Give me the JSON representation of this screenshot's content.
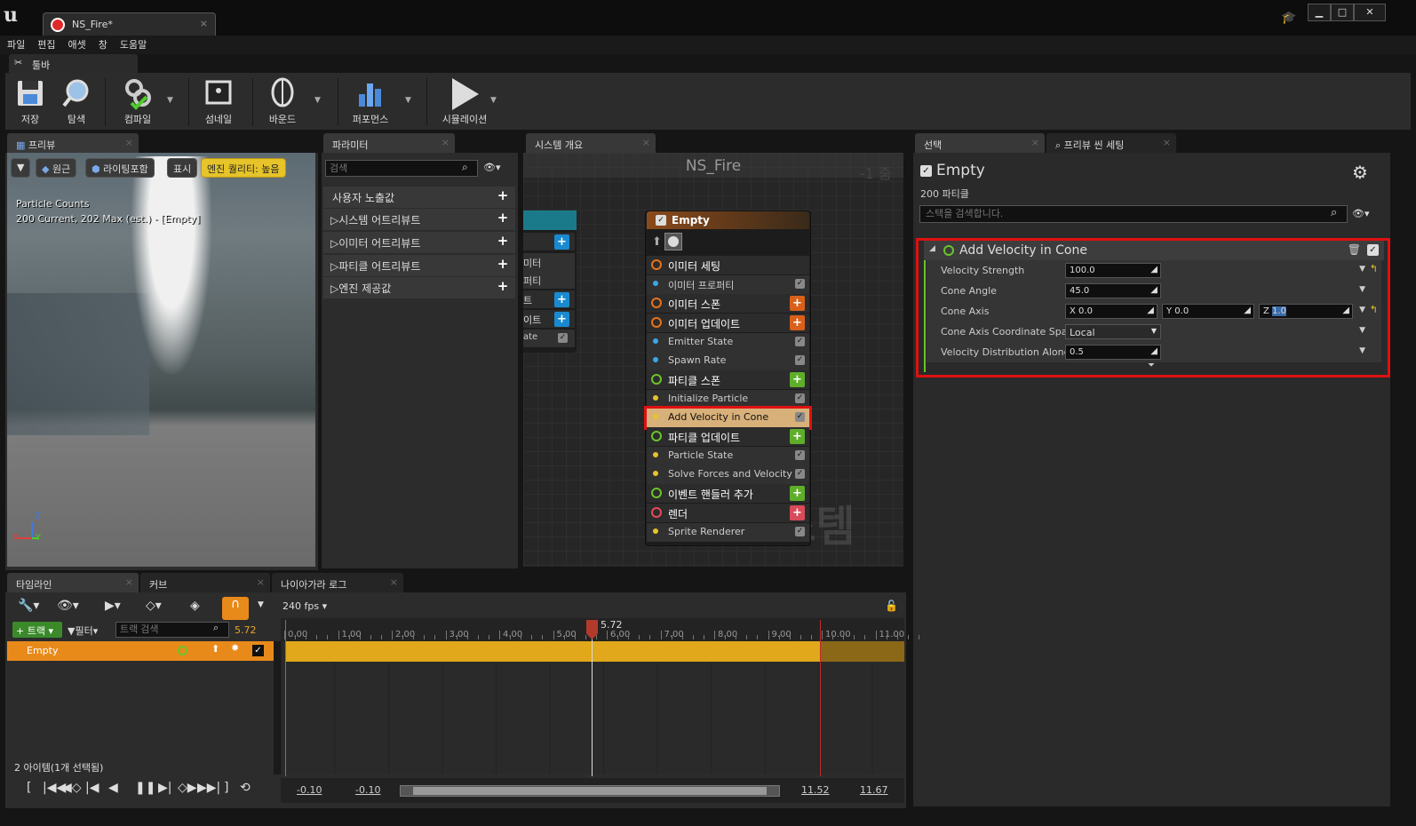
{
  "window": {
    "tab_title": "NS_Fire*"
  },
  "menu": [
    "파일",
    "편집",
    "애셋",
    "창",
    "도움말"
  ],
  "toolbar": {
    "tab_label": "툴바",
    "items": [
      {
        "label": "저장",
        "icon": "save-icon"
      },
      {
        "label": "탐색",
        "icon": "browse-icon"
      },
      {
        "label": "컴파일",
        "icon": "compile-icon"
      },
      {
        "label": "섬네일",
        "icon": "thumbnail-icon"
      },
      {
        "label": "바운드",
        "icon": "bounds-icon"
      },
      {
        "label": "퍼포먼스",
        "icon": "performance-icon"
      },
      {
        "label": "시뮬레이션",
        "icon": "simulation-icon"
      }
    ]
  },
  "preview": {
    "tab": "프리뷰",
    "btn_perspective": "원근",
    "btn_lit": "라이팅포함",
    "btn_show": "표시",
    "btn_quality": "엔진 퀄리티: 높음",
    "stats_line1": "Particle Counts",
    "stats_line2": "200 Current, 202 Max (est.) - [Empty]",
    "axis_z": "Z",
    "axis_y": "Y",
    "axis_x": "X"
  },
  "params": {
    "tab": "파라미터",
    "search_placeholder": "검색",
    "rows": [
      "사용자 노출값",
      "시스템 어트리뷰트",
      "이미터 어트리뷰트",
      "파티클 어트리뷰트",
      "엔진 제공값"
    ]
  },
  "overview": {
    "tab": "시스템 개요",
    "title": "NS_Fire",
    "zoom": "-1 줌",
    "watermark": "시스템",
    "left_node_rows": [
      "미터",
      "퍼티",
      "트",
      "이트",
      "ate"
    ],
    "node": {
      "title": "Empty",
      "rows": [
        {
          "label": "이미터 세팅",
          "kind": "hdr",
          "color": "#e8731a"
        },
        {
          "label": "이미터 프로퍼티",
          "kind": "sub"
        },
        {
          "label": "이미터 스폰",
          "kind": "hdr",
          "color": "#e8731a",
          "plus": "#d9601a"
        },
        {
          "label": "이미터 업데이트",
          "kind": "hdr",
          "color": "#e8731a",
          "plus": "#d9601a"
        },
        {
          "label": "Emitter State",
          "kind": "sub"
        },
        {
          "label": "Spawn Rate",
          "kind": "sub"
        },
        {
          "label": "파티클 스폰",
          "kind": "hdr",
          "color": "#6ac42a",
          "plus": "#5fae2a"
        },
        {
          "label": "Initialize Particle",
          "kind": "sub"
        },
        {
          "label": "Add Velocity in Cone",
          "kind": "sel"
        },
        {
          "label": "파티클 업데이트",
          "kind": "hdr",
          "color": "#6ac42a",
          "plus": "#5fae2a"
        },
        {
          "label": "Particle State",
          "kind": "sub"
        },
        {
          "label": "Solve Forces and Velocity",
          "kind": "sub"
        },
        {
          "label": "이벤트 핸들러 추가",
          "kind": "hdr",
          "color": "#6ac42a",
          "plus": "#5fae2a"
        },
        {
          "label": "렌더",
          "kind": "hdr",
          "color": "#e84a5a",
          "plus": "#d94a5a"
        },
        {
          "label": "Sprite Renderer",
          "kind": "sub"
        }
      ]
    }
  },
  "selection": {
    "tab": "선택",
    "tab2": "프리뷰 씬 세팅",
    "emitter_name": "Empty",
    "count": "200 파티클",
    "search_placeholder": "스택을 검색합니다.",
    "module": "Add Velocity in Cone",
    "props": [
      {
        "name": "Velocity Strength",
        "value": "100.0"
      },
      {
        "name": "Cone Angle",
        "value": "45.0"
      },
      {
        "name": "Cone Axis",
        "x": "0.0",
        "y": "0.0",
        "z": "1.0"
      },
      {
        "name": "Cone Axis Coordinate Spac",
        "value": "Local"
      },
      {
        "name": "Velocity Distribution Along",
        "value": "0.5"
      }
    ]
  },
  "timeline": {
    "tabs": [
      "타임라인",
      "커브",
      "나이아가라 로그"
    ],
    "fps": "240 fps",
    "track_btn": "트랙",
    "filter_btn": "필터",
    "search_placeholder": "트랙 검색",
    "time": "5.72",
    "track_name": "Empty",
    "items_count": "2 아이템(1개 선택됨)",
    "ruler": [
      "0.00",
      "1.00",
      "2.00",
      "3.00",
      "4.00",
      "5.00",
      "6.00",
      "7.00",
      "8.00",
      "9.00",
      "10.00",
      "11.00"
    ],
    "bottom": [
      "-0.10",
      "-0.10",
      "11.52",
      "11.67"
    ]
  }
}
